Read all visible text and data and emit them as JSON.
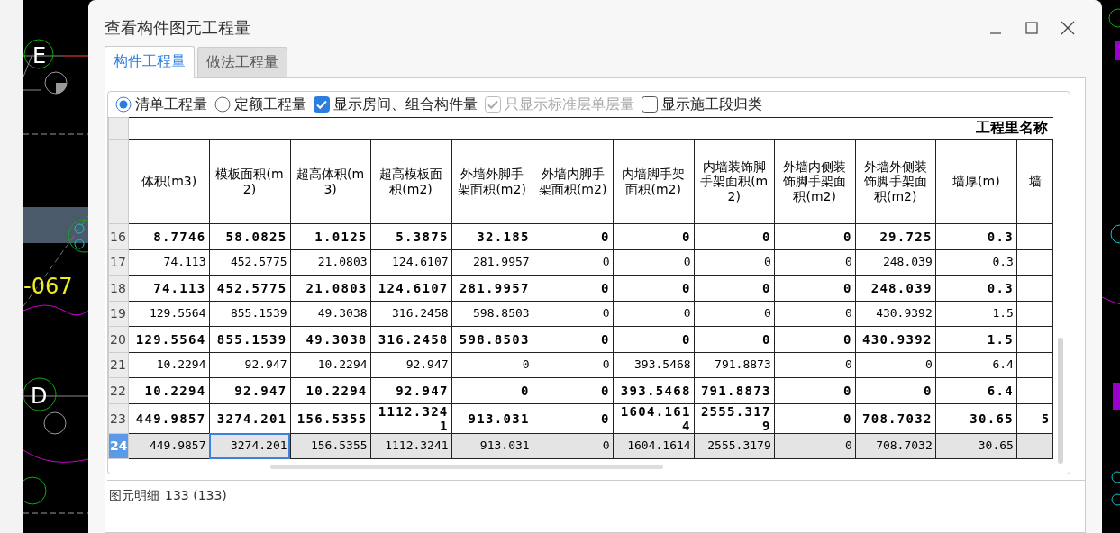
{
  "cad": {
    "labels": [
      {
        "text": "E",
        "kind": "axis"
      },
      {
        "text": "-067",
        "kind": "dimension"
      },
      {
        "text": "D",
        "kind": "axis"
      }
    ]
  },
  "window": {
    "title": "查看构件图元工程量"
  },
  "tabs": [
    {
      "label": "构件工程量",
      "selected": true
    },
    {
      "label": "做法工程量",
      "selected": false
    }
  ],
  "options": [
    {
      "kind": "radio",
      "label": "清单工程量",
      "checked": true,
      "disabled": false
    },
    {
      "kind": "radio",
      "label": "定额工程量",
      "checked": false,
      "disabled": false
    },
    {
      "kind": "checkbox",
      "label": "显示房间、组合构件量",
      "checked": true,
      "disabled": false
    },
    {
      "kind": "checkbox",
      "label": "只显示标准层单层量",
      "checked": true,
      "disabled": true
    },
    {
      "kind": "checkbox",
      "label": "显示施工段归类",
      "checked": false,
      "disabled": false
    }
  ],
  "table": {
    "group_header": "工程里名称",
    "columns": [
      "体积(m3)",
      "模板面积(m2)",
      "超高体积(m3)",
      "超高模板面积(m2)",
      "外墙外脚手架面积(m2)",
      "外墙内脚手架面积(m2)",
      "内墙脚手架面积(m2)",
      "内墙装饰脚手架面积(m2)",
      "外墙内侧装饰脚手架面积(m2)",
      "外墙外侧装饰脚手架面积(m2)",
      "墙厚(m)",
      "墙"
    ],
    "rows": [
      {
        "number": "16",
        "bold": true,
        "selected": false,
        "cells": [
          "8.7746",
          "58.0825",
          "1.0125",
          "5.3875",
          "32.185",
          "0",
          "0",
          "0",
          "0",
          "29.725",
          "0.3"
        ]
      },
      {
        "number": "17",
        "bold": false,
        "selected": false,
        "cells": [
          "74.113",
          "452.5775",
          "21.0803",
          "124.6107",
          "281.9957",
          "0",
          "0",
          "0",
          "0",
          "248.039",
          "0.3"
        ]
      },
      {
        "number": "18",
        "bold": true,
        "selected": false,
        "cells": [
          "74.113",
          "452.5775",
          "21.0803",
          "124.6107",
          "281.9957",
          "0",
          "0",
          "0",
          "0",
          "248.039",
          "0.3"
        ]
      },
      {
        "number": "19",
        "bold": false,
        "selected": false,
        "cells": [
          "129.5564",
          "855.1539",
          "49.3038",
          "316.2458",
          "598.8503",
          "0",
          "0",
          "0",
          "0",
          "430.9392",
          "1.5"
        ]
      },
      {
        "number": "20",
        "bold": true,
        "selected": false,
        "cells": [
          "129.5564",
          "855.1539",
          "49.3038",
          "316.2458",
          "598.8503",
          "0",
          "0",
          "0",
          "0",
          "430.9392",
          "1.5"
        ]
      },
      {
        "number": "21",
        "bold": false,
        "selected": false,
        "cells": [
          "10.2294",
          "92.947",
          "10.2294",
          "92.947",
          "0",
          "0",
          "393.5468",
          "791.8873",
          "0",
          "0",
          "6.4"
        ]
      },
      {
        "number": "22",
        "bold": true,
        "selected": false,
        "cells": [
          "10.2294",
          "92.947",
          "10.2294",
          "92.947",
          "0",
          "0",
          "393.5468",
          "791.8873",
          "0",
          "0",
          "6.4"
        ]
      },
      {
        "number": "23",
        "bold": true,
        "selected": false,
        "cells": [
          "449.9857",
          "3274.201",
          "156.5355",
          "1112.3241",
          "913.031",
          "0",
          "1604.1614",
          "2555.3179",
          "0",
          "708.7032",
          "30.65",
          "5"
        ]
      },
      {
        "number": "24",
        "bold": false,
        "selected": true,
        "cells": [
          "449.9857",
          {
            "text": "3274.201",
            "focused": true
          },
          "156.5355",
          "1112.3241",
          "913.031",
          "0",
          "1604.1614",
          "2555.3179",
          "0",
          "708.7032",
          "30.65"
        ]
      }
    ]
  },
  "details": {
    "label": "图元明细",
    "count": "133 (133)"
  }
}
